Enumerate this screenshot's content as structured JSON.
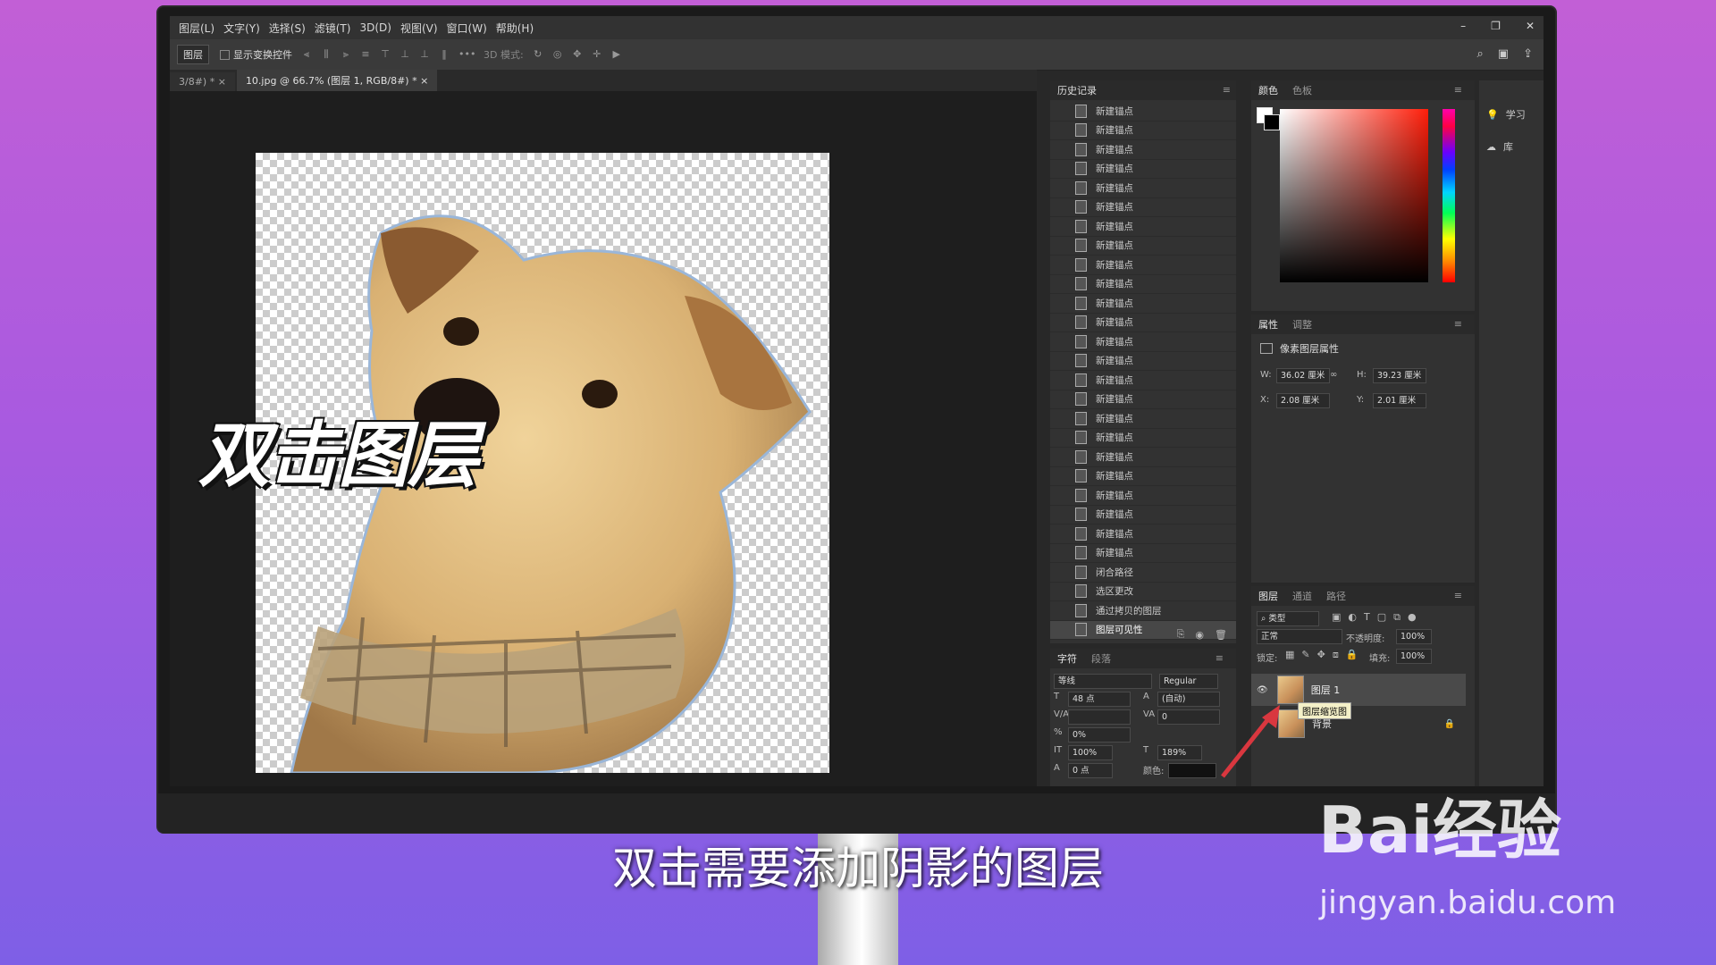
{
  "menu": [
    "图层(L)",
    "文字(Y)",
    "选择(S)",
    "滤镜(T)",
    "3D(D)",
    "视图(V)",
    "窗口(W)",
    "帮助(H)"
  ],
  "options": {
    "select": "图层",
    "show_transform": "显示变换控件",
    "mode3d": "3D 模式:"
  },
  "tabs": [
    {
      "label": "3/8#) *"
    },
    {
      "label": "10.jpg @ 66.7% (图层 1, RGB/8#) *"
    }
  ],
  "history": {
    "title": "历史记录",
    "items": [
      "新建锚点",
      "新建锚点",
      "新建锚点",
      "新建锚点",
      "新建锚点",
      "新建锚点",
      "新建锚点",
      "新建锚点",
      "新建锚点",
      "新建锚点",
      "新建锚点",
      "新建锚点",
      "新建锚点",
      "新建锚点",
      "新建锚点",
      "新建锚点",
      "新建锚点",
      "新建锚点",
      "新建锚点",
      "新建锚点",
      "新建锚点",
      "新建锚点",
      "新建锚点",
      "新建锚点",
      "闭合路径",
      "选区更改",
      "通过拷贝的图层",
      "图层可见性"
    ]
  },
  "character": {
    "tabs": [
      "字符",
      "段落"
    ],
    "font": "等线",
    "style": "Regular",
    "size": "48 点",
    "leading": "(自动)",
    "tracking": "0",
    "vscale_pct": "0%",
    "hscale": "100%",
    "vscale": "189%",
    "baseline": "0 点",
    "color_label": "颜色:"
  },
  "color": {
    "tabs": [
      "颜色",
      "色板"
    ]
  },
  "properties": {
    "tabs": [
      "属性",
      "调整"
    ],
    "section": "像素图层属性",
    "w_label": "W:",
    "w": "36.02 厘米",
    "h_label": "H:",
    "h": "39.23 厘米",
    "x_label": "X:",
    "x": "2.08 厘米",
    "y_label": "Y:",
    "y": "2.01 厘米"
  },
  "layers": {
    "tabs": [
      "图层",
      "通道",
      "路径"
    ],
    "filter": "类型",
    "blend": "正常",
    "opacity_label": "不透明度:",
    "opacity": "100%",
    "lock_label": "锁定:",
    "fill_label": "填充:",
    "fill": "100%",
    "items": [
      {
        "name": "图层 1"
      },
      {
        "name": "背景"
      }
    ],
    "tooltip": "图层缩览图"
  },
  "side": {
    "learn": "学习",
    "library": "库"
  },
  "overlay": {
    "title": "双击图层",
    "subtitle": "双击需要添加阴影的图层",
    "watermark_brand": "Bai经验",
    "watermark_url": "jingyan.baidu.com"
  },
  "colors": {
    "accent_red": "#d9373f",
    "panel": "#323232"
  }
}
